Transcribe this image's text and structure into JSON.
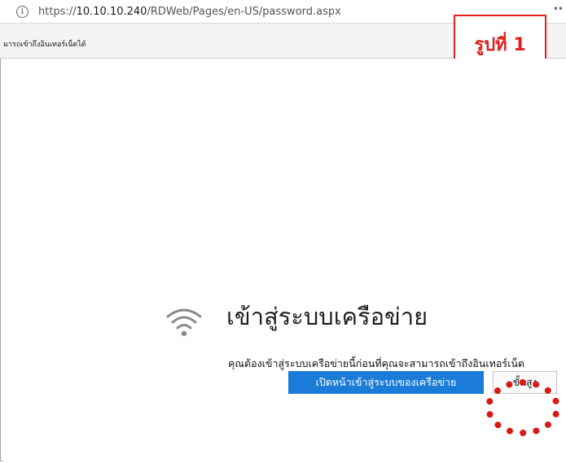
{
  "browser": {
    "info_icon": "info-icon",
    "url_prefix": "https://",
    "url_host": "10.10.10.240",
    "url_path": "/RDWeb/Pages/en-US/password.aspx",
    "more_icon": "ellipsis-icon"
  },
  "notification": {
    "text": "มารถเข้าถึงอินเทอร์เน็ตได้"
  },
  "annotation": {
    "label": "รูปที่ 1",
    "accent_color": "#e0201b"
  },
  "captive_portal": {
    "icon": "wifi-icon",
    "headline": "เข้าสู่ระบบเครือข่าย",
    "description": "คุณต้องเข้าสู่ระบบเครือข่ายนี้ก่อนที่คุณจะสามารถเข้าถึงอินเทอร์เน็ต",
    "primary_button": "เปิดหน้าเข้าสู่ระบบของเครือข่าย",
    "advanced_button": "ขั้นสูง",
    "primary_color": "#1a7cd8"
  }
}
